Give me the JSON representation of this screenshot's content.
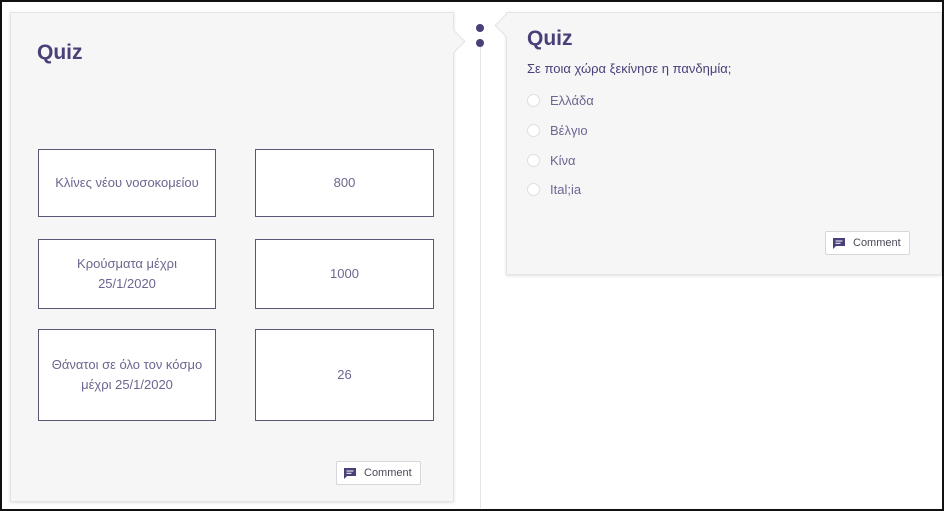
{
  "left_quiz": {
    "title": "Quiz",
    "pairs": [
      {
        "label": "Κλίνες νέου νοσοκομείου",
        "value": "800"
      },
      {
        "label": "Κρούσματα μέχρι 25/1/2020",
        "value": "1000"
      },
      {
        "label": "Θάνατοι σε όλο τον κόσμο μέχρι 25/1/2020",
        "value": "26"
      }
    ],
    "comment_label": "Comment"
  },
  "right_quiz": {
    "title": "Quiz",
    "question": "Σε ποια χώρα ξεκίνησε η πανδημία;",
    "options": [
      "Ελλάδα",
      "Βέλγιο",
      "Κίνα",
      "Ital;ia"
    ],
    "comment_label": "Comment"
  },
  "colors": {
    "title": "#4a3f78",
    "card_bg": "#f6f6f7",
    "box_border": "#5b5674",
    "text_muted": "#6c6690"
  }
}
